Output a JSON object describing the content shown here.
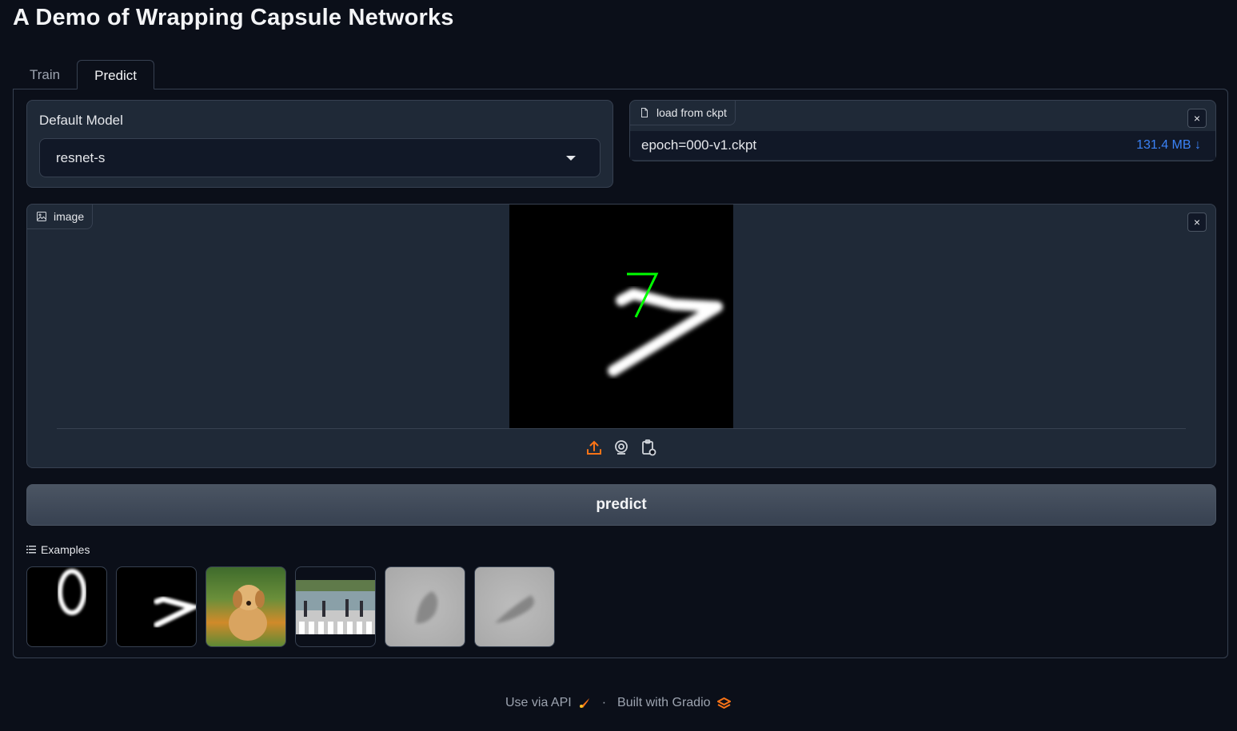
{
  "page": {
    "title": "A Demo of Wrapping Capsule Networks"
  },
  "tabs": [
    {
      "label": "Train",
      "active": false
    },
    {
      "label": "Predict",
      "active": true
    }
  ],
  "model_dropdown": {
    "label": "Default Model",
    "value": "resnet-s"
  },
  "ckpt": {
    "badge_label": "load from ckpt",
    "file_name": "epoch=000-v1.ckpt",
    "file_size": "131.4 MB ↓",
    "close_symbol": "×"
  },
  "image_input": {
    "badge_label": "image",
    "close_symbol": "×",
    "tools": [
      "upload-icon",
      "webcam-icon",
      "clipboard-icon"
    ]
  },
  "predict_button": {
    "label": "predict"
  },
  "examples": {
    "label": "Examples",
    "items": [
      "digit-zero",
      "digit-seven",
      "puppy",
      "street-crossing",
      "gray-shape-1",
      "gray-shape-2"
    ]
  },
  "footer": {
    "api_label": "Use via API",
    "separator": "·",
    "built_label": "Built with Gradio"
  },
  "colors": {
    "background": "#0b0f19",
    "block": "#1f2937",
    "accent": "#f97316",
    "link": "#3b82f6"
  }
}
